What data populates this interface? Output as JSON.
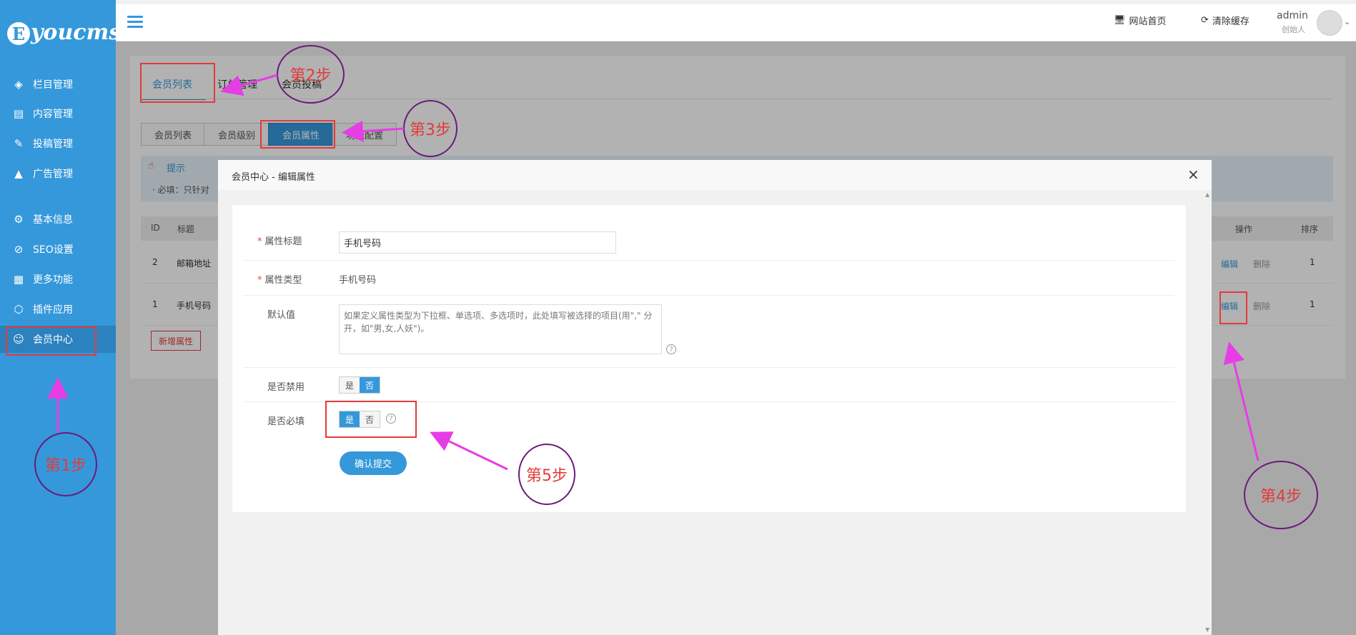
{
  "brand": {
    "letter": "E",
    "text": "youcms"
  },
  "sidebar": {
    "items": [
      {
        "label": "栏目管理",
        "icon": "layers-icon"
      },
      {
        "label": "内容管理",
        "icon": "document-icon"
      },
      {
        "label": "投稿管理",
        "icon": "edit-document-icon"
      },
      {
        "label": "广告管理",
        "icon": "ad-icon"
      },
      {
        "label": "基本信息",
        "icon": "gear-icon"
      },
      {
        "label": "SEO设置",
        "icon": "seo-icon"
      },
      {
        "label": "更多功能",
        "icon": "grid-icon"
      },
      {
        "label": "插件应用",
        "icon": "cube-icon"
      },
      {
        "label": "会员中心",
        "icon": "user-icon",
        "active": true
      }
    ]
  },
  "header": {
    "site_home": "网站首页",
    "clear_cache": "清除缓存",
    "user_name": "admin",
    "user_role": "创始人"
  },
  "main": {
    "tabs": [
      "会员列表",
      "订单管理",
      "会员投稿"
    ],
    "subtabs": [
      "会员列表",
      "会员级别",
      "会员属性",
      "功能配置"
    ],
    "tip_title": "提示",
    "tip_text": "· 必填：只针对",
    "table_headers": {
      "id": "ID",
      "title": "标题",
      "actions": "操作",
      "sort": "排序"
    },
    "rows": [
      {
        "id": "2",
        "title": "邮箱地址",
        "edit": "编辑",
        "delete": "删除",
        "sort": "1"
      },
      {
        "id": "1",
        "title": "手机号码",
        "edit": "编辑",
        "delete": "删除",
        "sort": "1"
      }
    ],
    "add_button": "新增属性"
  },
  "modal": {
    "title": "会员中心 - 编辑属性",
    "fields": {
      "title_label": "属性标题",
      "title_value": "手机号码",
      "type_label": "属性类型",
      "type_value": "手机号码",
      "default_label": "默认值",
      "default_placeholder": "如果定义属性类型为下拉框、单选项、多选项时，此处填写被选择的项目(用\",\" 分开，如\"男,女,人妖\")。",
      "disabled_label": "是否禁用",
      "required_label": "是否必填",
      "yes": "是",
      "no": "否",
      "help_glyph": "?"
    },
    "submit": "确认提交",
    "disabled_selected": "否",
    "required_selected": "是"
  },
  "annotations": {
    "step1": "第1步",
    "step2": "第2步",
    "step3": "第3步",
    "step4": "第4步",
    "step5": "第5步"
  },
  "colors": {
    "primary": "#3598db",
    "annotation_red": "#e23b3b",
    "annotation_purple": "#6b1b7a",
    "arrow": "#e63de6"
  }
}
